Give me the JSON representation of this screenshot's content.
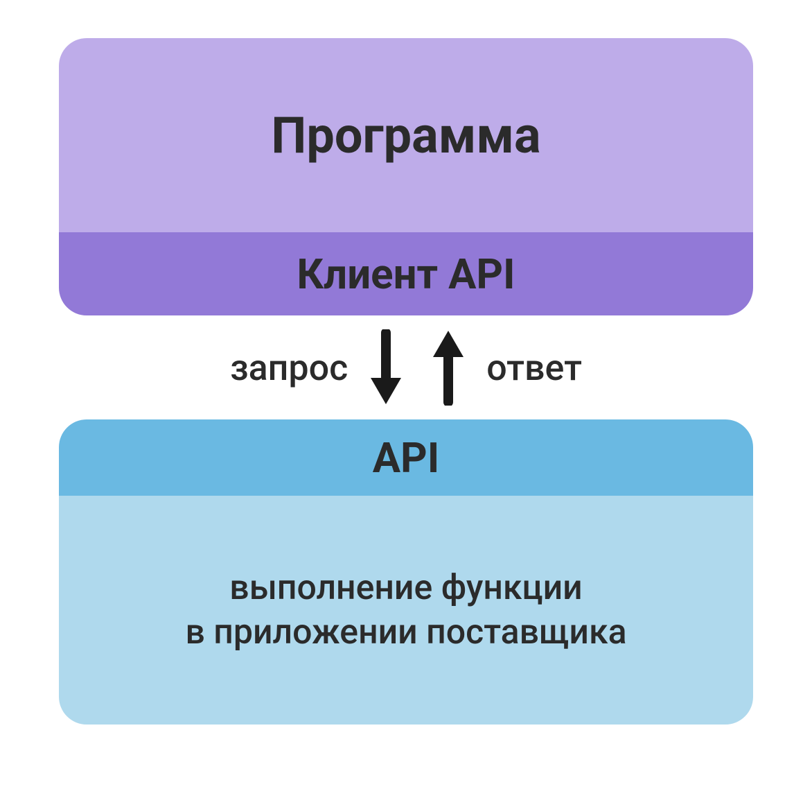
{
  "colors": {
    "program_bg": "#BEACE9",
    "client_bg": "#9279D7",
    "api_header_bg": "#6AB9E2",
    "api_body_bg": "#AFD9ED",
    "text": "#2b2b2b"
  },
  "top": {
    "program_label": "Программа",
    "client_label": "Клиент API"
  },
  "arrows": {
    "request_label": "запрос",
    "response_label": "ответ"
  },
  "bottom": {
    "api_label": "API",
    "desc_line1": "выполнение функции",
    "desc_line2": "в приложении поставщика"
  }
}
